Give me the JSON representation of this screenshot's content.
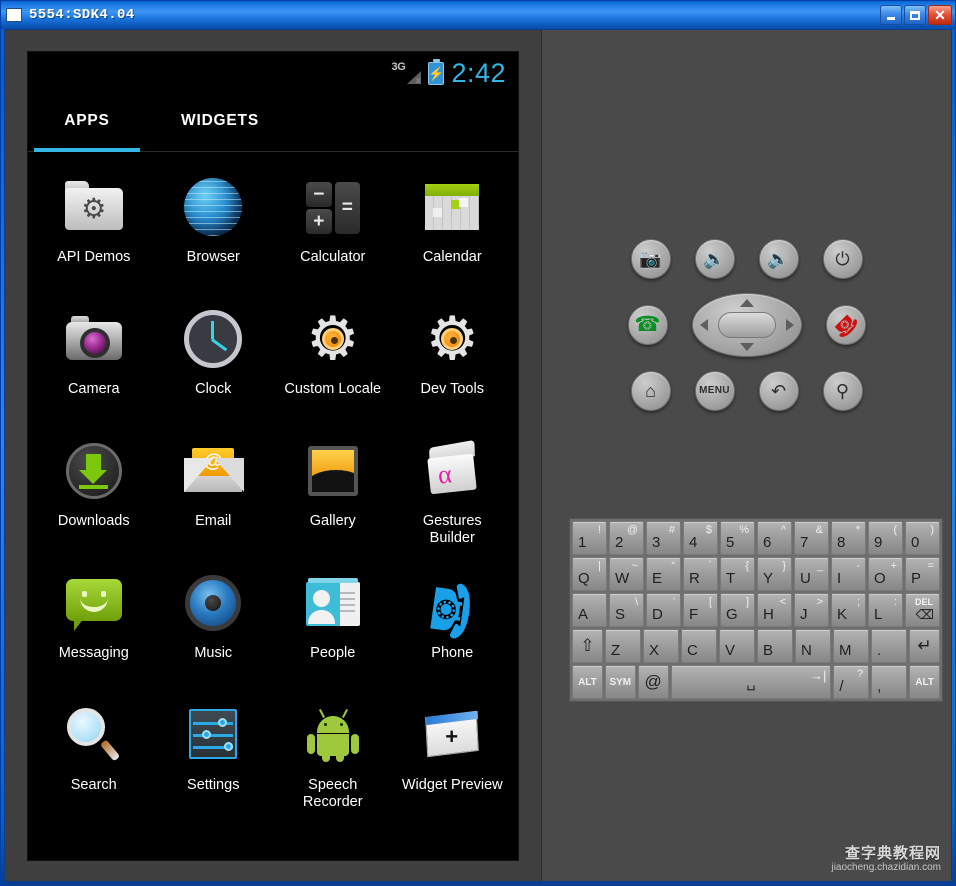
{
  "window": {
    "title": "5554:SDK4.04",
    "minimize_label": "Minimize",
    "maximize_label": "Maximize",
    "close_label": "Close"
  },
  "statusbar": {
    "network": "3G",
    "network_state": "x",
    "battery": "charging",
    "clock": "2:42",
    "clock_color": "#33b5e5"
  },
  "tabs": [
    {
      "label": "APPS",
      "active": true
    },
    {
      "label": "WIDGETS",
      "active": false
    }
  ],
  "accent_color": "#33b5e5",
  "apps": [
    {
      "label": "API Demos",
      "icon": "folder-gear-icon"
    },
    {
      "label": "Browser",
      "icon": "globe-icon"
    },
    {
      "label": "Calculator",
      "icon": "calculator-keys-icon"
    },
    {
      "label": "Calendar",
      "icon": "calendar-grid-icon"
    },
    {
      "label": "Camera",
      "icon": "camera-icon"
    },
    {
      "label": "Clock",
      "icon": "analog-clock-icon"
    },
    {
      "label": "Custom Locale",
      "icon": "gear-icon"
    },
    {
      "label": "Dev Tools",
      "icon": "gear-icon"
    },
    {
      "label": "Downloads",
      "icon": "download-arrow-icon"
    },
    {
      "label": "Email",
      "icon": "envelope-at-icon"
    },
    {
      "label": "Gallery",
      "icon": "photo-frame-icon"
    },
    {
      "label": "Gestures Builder",
      "icon": "gesture-pad-icon"
    },
    {
      "label": "Messaging",
      "icon": "speech-bubble-smiley-icon"
    },
    {
      "label": "Music",
      "icon": "speaker-icon"
    },
    {
      "label": "People",
      "icon": "contact-card-icon"
    },
    {
      "label": "Phone",
      "icon": "handset-icon"
    },
    {
      "label": "Search",
      "icon": "magnifier-icon"
    },
    {
      "label": "Settings",
      "icon": "sliders-icon"
    },
    {
      "label": "Speech Recorder",
      "icon": "android-robot-icon"
    },
    {
      "label": "Widget Preview",
      "icon": "widget-plus-icon"
    }
  ],
  "hardware_buttons": {
    "row1": [
      {
        "name": "camera-button",
        "glyph": "▣"
      },
      {
        "name": "volume-down-button",
        "glyph": "◀"
      },
      {
        "name": "volume-up-button",
        "glyph": "◀"
      },
      {
        "name": "power-button",
        "glyph": "⏻"
      }
    ],
    "row2": [
      {
        "name": "call-button",
        "glyph": "✆"
      },
      {
        "name": "dpad",
        "glyph": ""
      },
      {
        "name": "endcall-button",
        "glyph": "✆"
      }
    ],
    "row3": [
      {
        "name": "home-button",
        "glyph": "⌂"
      },
      {
        "name": "menu-button",
        "glyph": "MENU"
      },
      {
        "name": "back-button",
        "glyph": "↶"
      },
      {
        "name": "search-button",
        "glyph": "⚲"
      }
    ]
  },
  "keyboard": {
    "rows": [
      [
        {
          "main": "1",
          "alt": "!"
        },
        {
          "main": "2",
          "alt": "@"
        },
        {
          "main": "3",
          "alt": "#"
        },
        {
          "main": "4",
          "alt": "$"
        },
        {
          "main": "5",
          "alt": "%"
        },
        {
          "main": "6",
          "alt": "^"
        },
        {
          "main": "7",
          "alt": "&"
        },
        {
          "main": "8",
          "alt": "*"
        },
        {
          "main": "9",
          "alt": "("
        },
        {
          "main": "0",
          "alt": ")"
        }
      ],
      [
        {
          "main": "Q",
          "alt": "|"
        },
        {
          "main": "W",
          "alt": "~"
        },
        {
          "main": "E",
          "alt": "“"
        },
        {
          "main": "R",
          "alt": "`"
        },
        {
          "main": "T",
          "alt": "{"
        },
        {
          "main": "Y",
          "alt": "}"
        },
        {
          "main": "U",
          "alt": "_"
        },
        {
          "main": "I",
          "alt": "-"
        },
        {
          "main": "O",
          "alt": "+"
        },
        {
          "main": "P",
          "alt": "="
        }
      ],
      [
        {
          "main": "A",
          "alt": ""
        },
        {
          "main": "S",
          "alt": "\\"
        },
        {
          "main": "D",
          "alt": "'"
        },
        {
          "main": "F",
          "alt": "["
        },
        {
          "main": "G",
          "alt": "]"
        },
        {
          "main": "H",
          "alt": "<"
        },
        {
          "main": "J",
          "alt": ">"
        },
        {
          "main": "K",
          "alt": ";"
        },
        {
          "main": "L",
          "alt": ":"
        },
        {
          "main": "DEL",
          "alt": ""
        }
      ],
      [
        {
          "main": "⇧",
          "alt": ""
        },
        {
          "main": "Z",
          "alt": ""
        },
        {
          "main": "X",
          "alt": ""
        },
        {
          "main": "C",
          "alt": ""
        },
        {
          "main": "V",
          "alt": ""
        },
        {
          "main": "B",
          "alt": ""
        },
        {
          "main": "N",
          "alt": ""
        },
        {
          "main": "M",
          "alt": ""
        },
        {
          "main": ".",
          "alt": ""
        },
        {
          "main": "↵",
          "alt": ""
        }
      ],
      [
        {
          "main": "ALT",
          "alt": ""
        },
        {
          "main": "SYM",
          "alt": ""
        },
        {
          "main": "@",
          "alt": ""
        },
        {
          "main": "␣",
          "alt": "→|"
        },
        {
          "main": "/",
          "alt": "?"
        },
        {
          "main": ",",
          "alt": ""
        },
        {
          "main": "ALT",
          "alt": ""
        }
      ]
    ]
  },
  "watermark": {
    "line1": "查字典教程网",
    "line2": "jiaocheng.chazidian.com"
  }
}
